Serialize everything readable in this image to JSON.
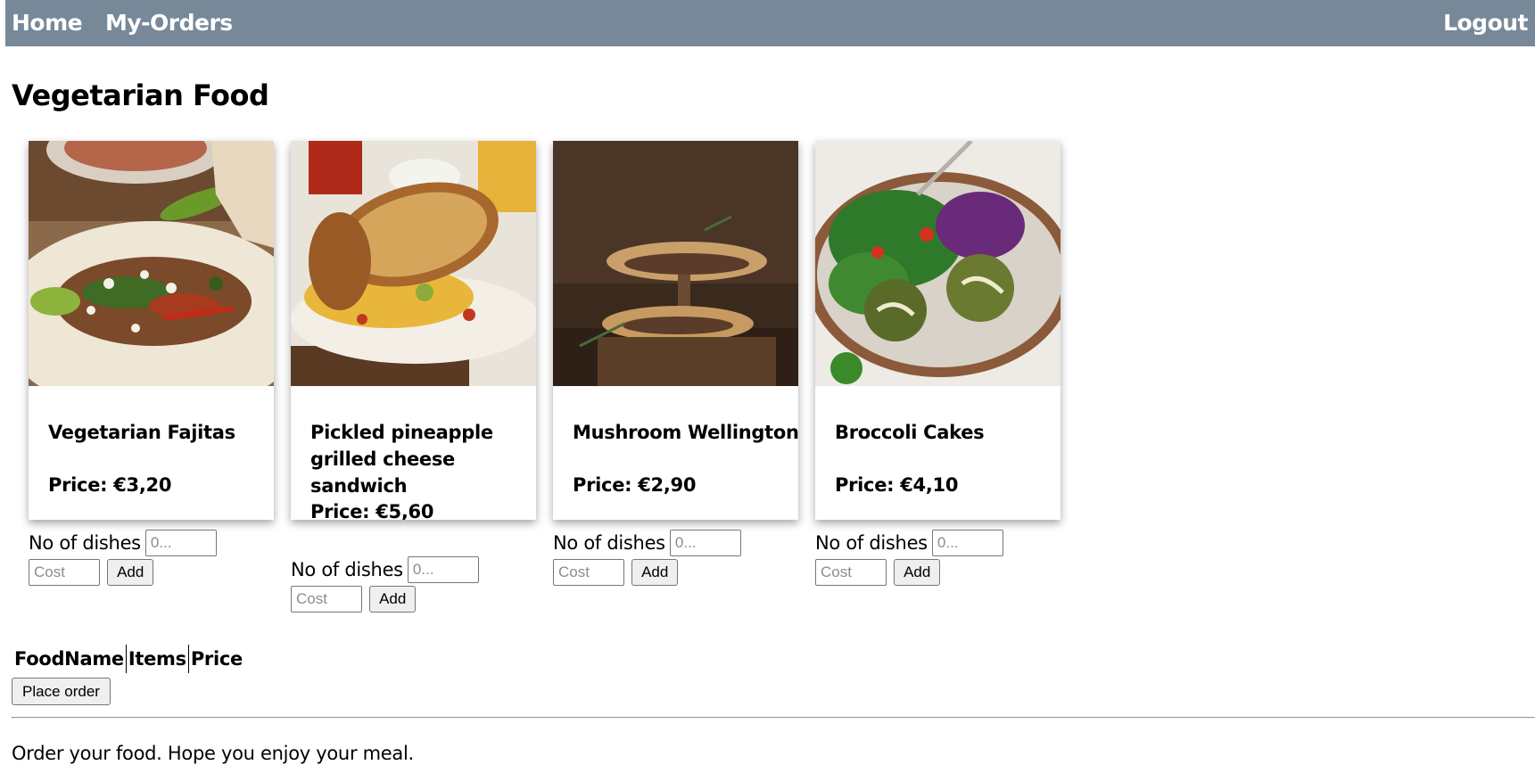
{
  "nav": {
    "home": "Home",
    "my_orders": "My-Orders",
    "logout": "Logout"
  },
  "page_title": "Vegetarian Food",
  "cards": [
    {
      "name": "Vegetarian Fajitas",
      "price": "Price: €3,20",
      "image": "vegetarian-fajitas-photo",
      "dishes_label": "No of dishes",
      "dishes_placeholder": "0...",
      "cost_placeholder": "Cost",
      "add_label": "Add"
    },
    {
      "name": "Pickled pineapple grilled cheese sandwich",
      "price": "Price: €5,60",
      "image": "grilled-cheese-sandwich-photo",
      "dishes_label": "No of dishes",
      "dishes_placeholder": "0...",
      "cost_placeholder": "Cost",
      "add_label": "Add"
    },
    {
      "name": "Mushroom Wellington",
      "price": "Price: €2,90",
      "image": "mushroom-wellington-photo",
      "dishes_label": "No of dishes",
      "dishes_placeholder": "0...",
      "cost_placeholder": "Cost",
      "add_label": "Add"
    },
    {
      "name": "Broccoli Cakes",
      "price": "Price: €4,10",
      "image": "broccoli-cakes-photo",
      "dishes_label": "No of dishes",
      "dishes_placeholder": "0...",
      "cost_placeholder": "Cost",
      "add_label": "Add"
    }
  ],
  "order_table": {
    "headers": [
      "FoodName",
      "Items",
      "Price"
    ]
  },
  "place_order_label": "Place order",
  "footer_text": "Order your food. Hope you enjoy your meal.",
  "colors": {
    "navbar": "#778899",
    "nav_text": "#ffffff"
  }
}
